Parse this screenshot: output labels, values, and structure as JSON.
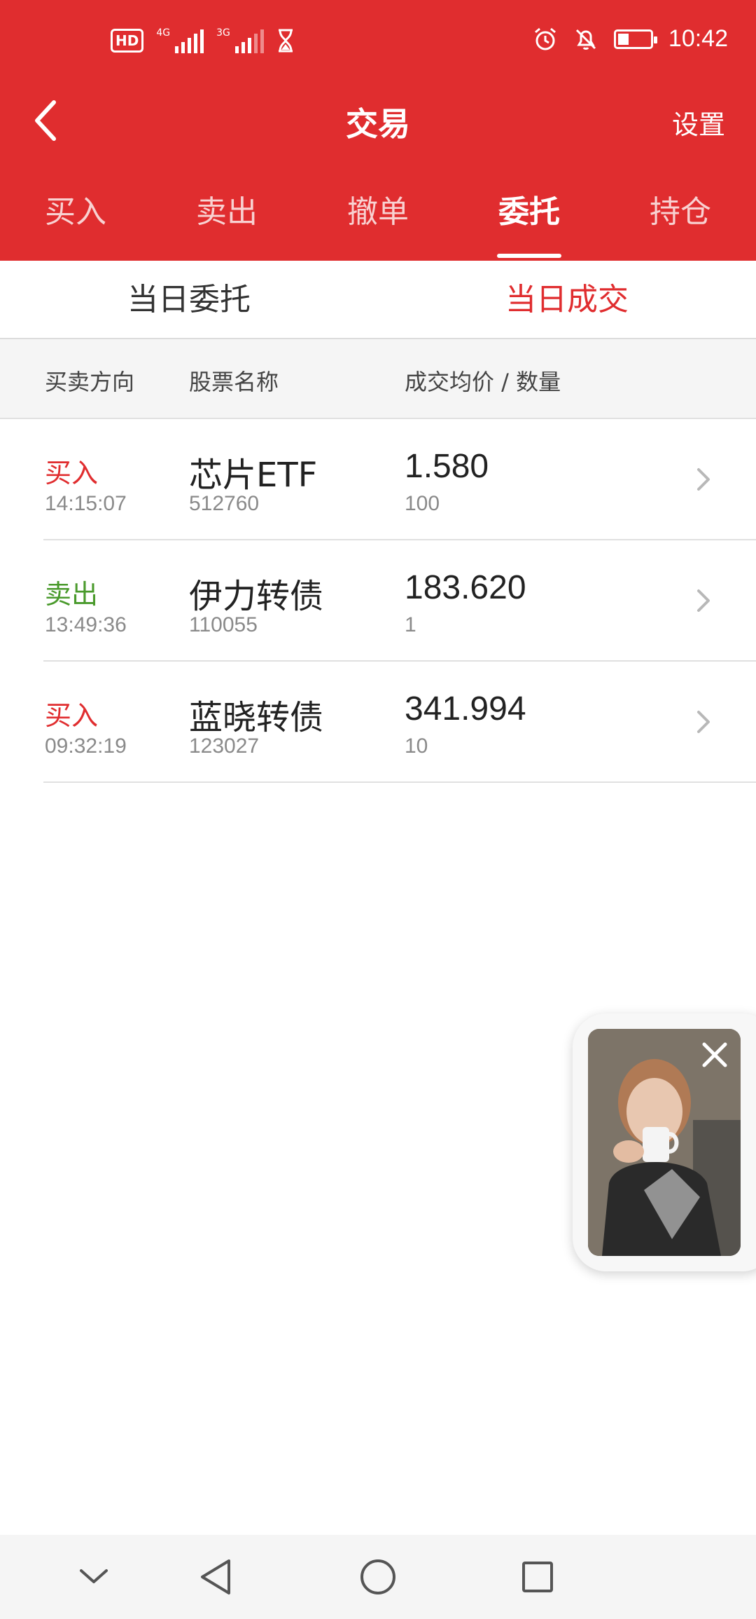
{
  "status_bar": {
    "hd": "HD",
    "sim1_net": "4G",
    "sim2_net": "3G",
    "time": "10:42",
    "battery_percent": 0.3
  },
  "nav": {
    "back_icon": "chevron-left-icon",
    "title": "交易",
    "settings_label": "设置"
  },
  "tabs": [
    {
      "label": "买入",
      "active": false
    },
    {
      "label": "卖出",
      "active": false
    },
    {
      "label": "撤单",
      "active": false
    },
    {
      "label": "委托",
      "active": true
    },
    {
      "label": "持仓",
      "active": false
    }
  ],
  "subtabs": [
    {
      "label": "当日委托",
      "active": false
    },
    {
      "label": "当日成交",
      "active": true
    }
  ],
  "columns": {
    "direction": "买卖方向",
    "name": "股票名称",
    "price_qty": "成交均价 / 数量"
  },
  "rows": [
    {
      "direction": "买入",
      "type": "buy",
      "time": "14:15:07",
      "name": "芯片ETF",
      "code": "512760",
      "price": "1.580",
      "qty": "100"
    },
    {
      "direction": "卖出",
      "type": "sell",
      "time": "13:49:36",
      "name": "伊力转债",
      "code": "110055",
      "price": "183.620",
      "qty": "1"
    },
    {
      "direction": "买入",
      "type": "buy",
      "time": "09:32:19",
      "name": "蓝晓转债",
      "code": "123027",
      "price": "341.994",
      "qty": "10"
    }
  ],
  "colors": {
    "brand_red": "#e02d2f",
    "sell_green": "#4a9a2c"
  }
}
